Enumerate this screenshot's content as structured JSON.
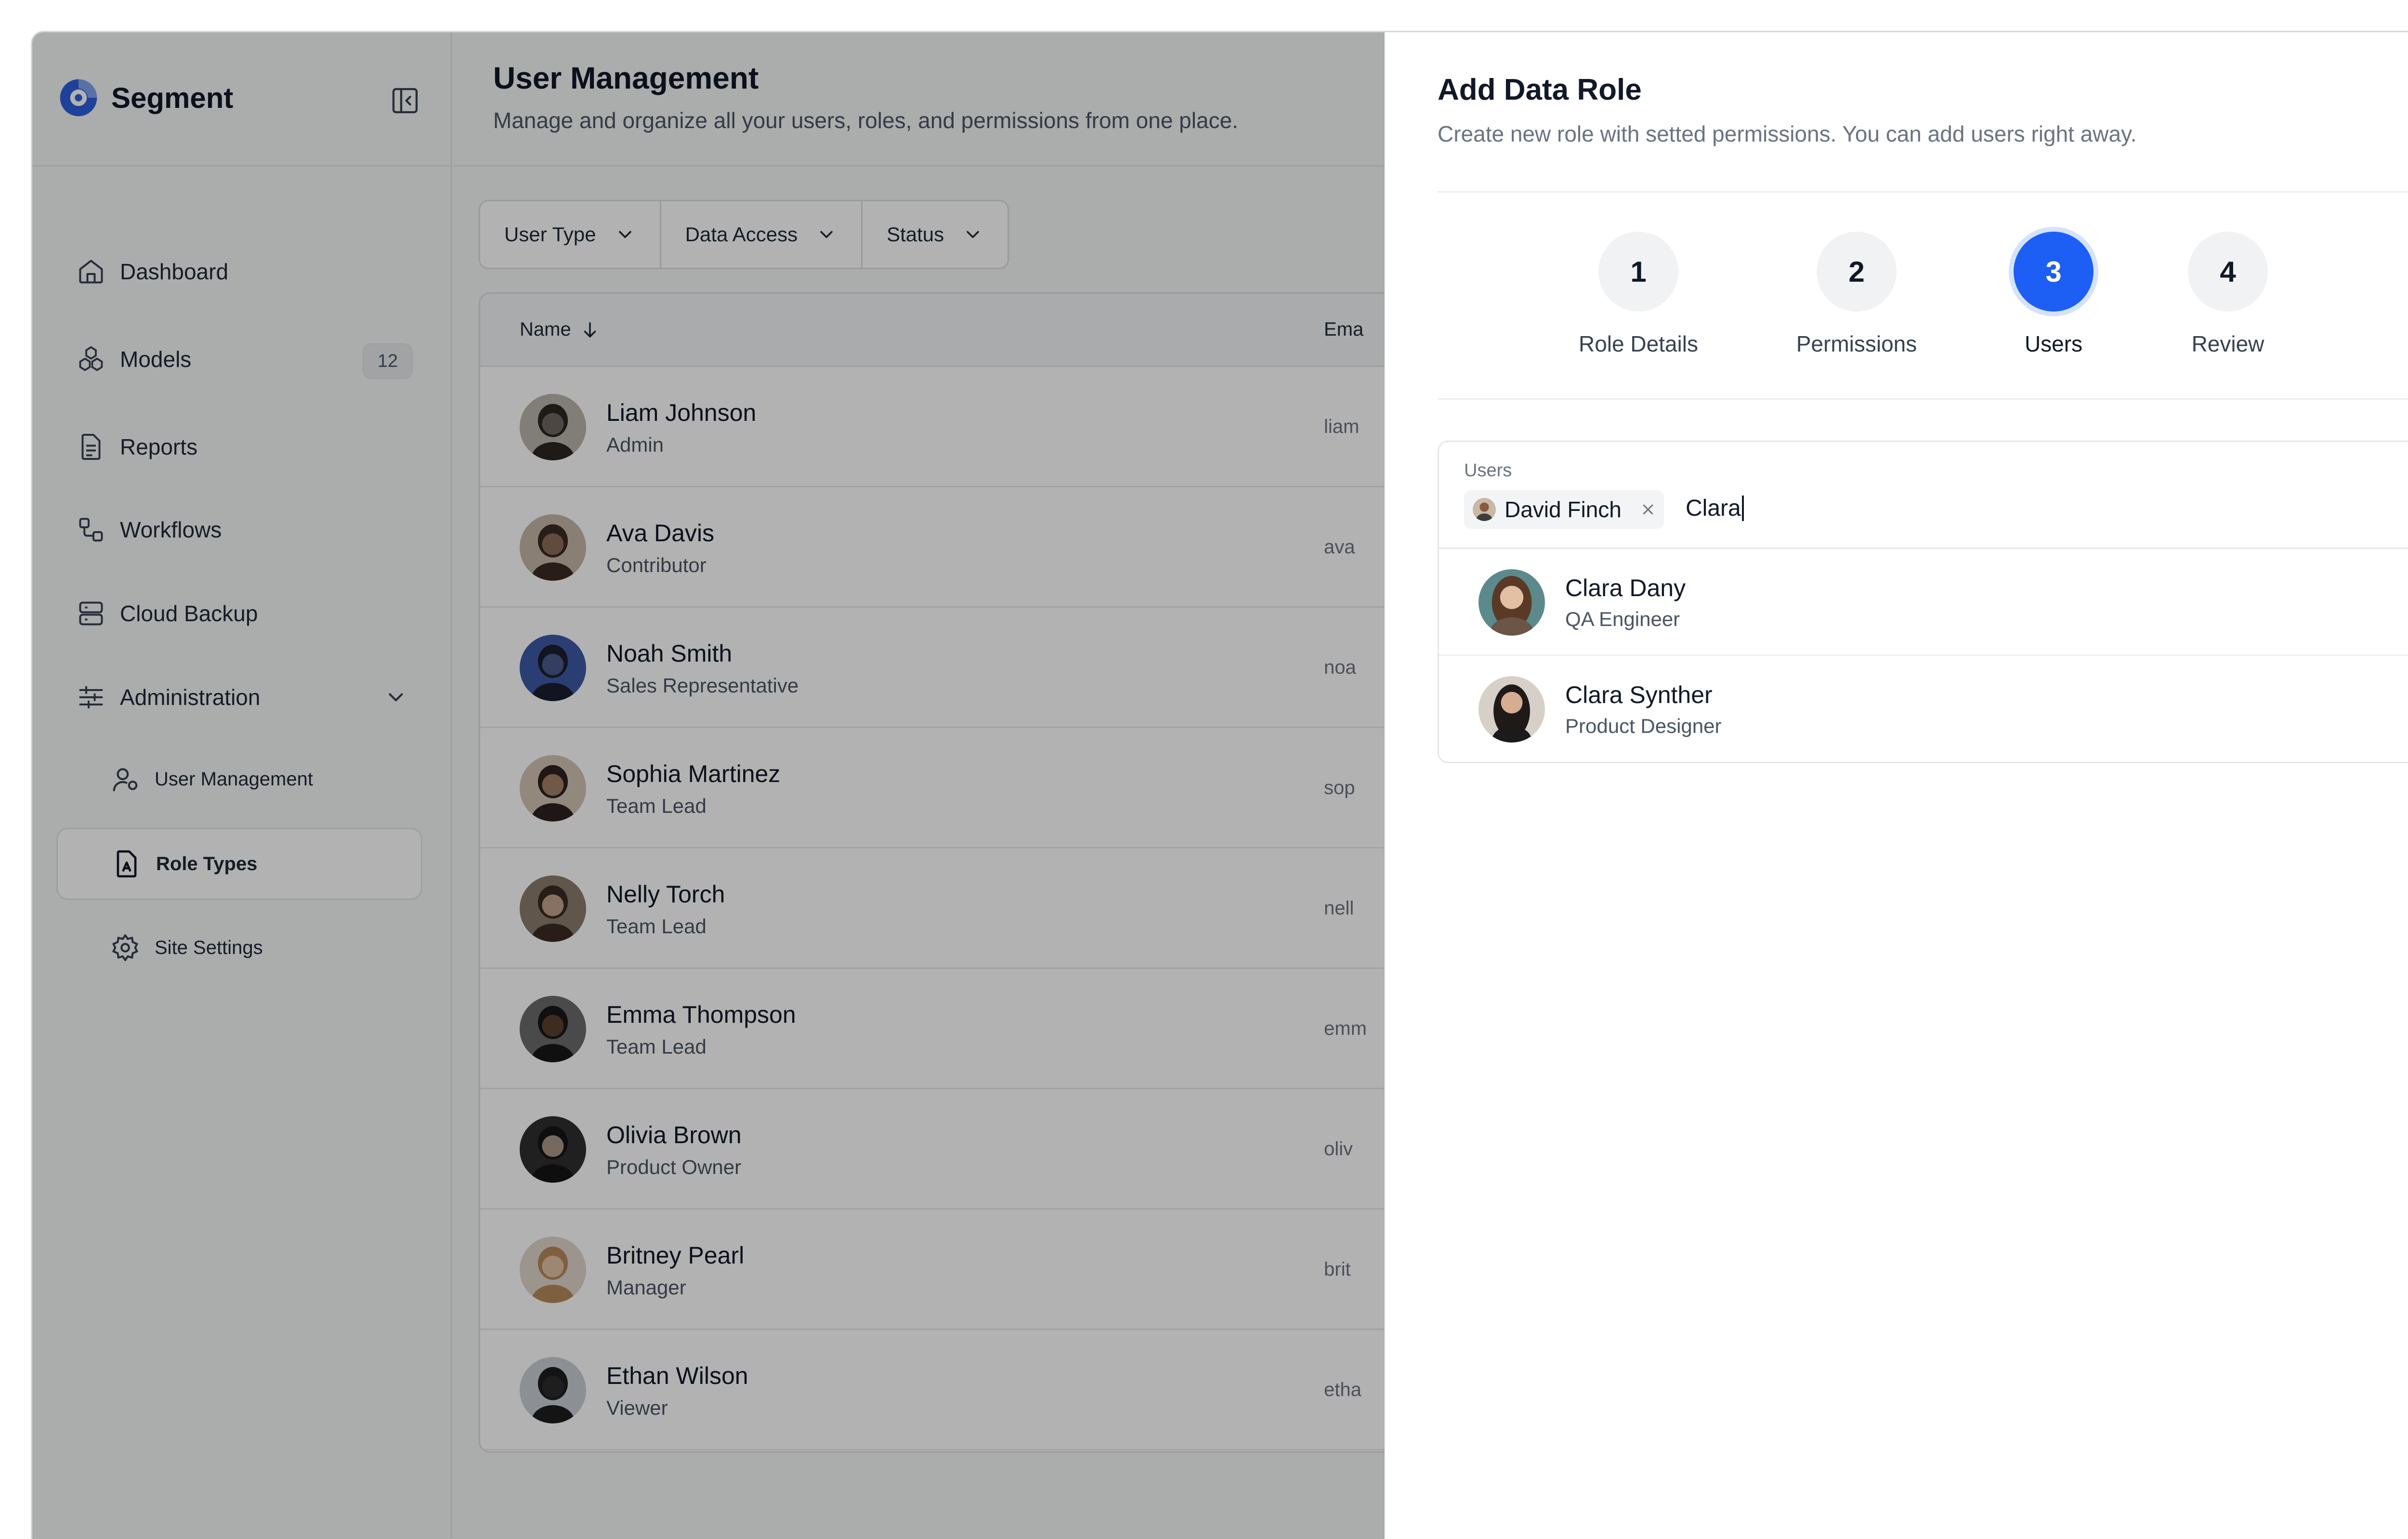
{
  "brand": {
    "name": "Segment"
  },
  "sidebar": {
    "items": [
      {
        "label": "Dashboard",
        "icon": "home-icon"
      },
      {
        "label": "Models",
        "icon": "cube-icon",
        "count": "12"
      },
      {
        "label": "Reports",
        "icon": "document-icon"
      },
      {
        "label": "Workflows",
        "icon": "workflow-icon"
      },
      {
        "label": "Cloud Backup",
        "icon": "server-icon"
      },
      {
        "label": "Administration",
        "icon": "sliders-icon"
      }
    ],
    "subitems": [
      {
        "label": "User Management",
        "icon": "user-gear-icon"
      },
      {
        "label": "Role Types",
        "icon": "role-file-icon",
        "active": true
      },
      {
        "label": "Site Settings",
        "icon": "gear-icon"
      }
    ]
  },
  "main": {
    "title": "User Management",
    "subtitle": "Manage and organize all your users, roles, and permissions from one place.",
    "filters": [
      "User Type",
      "Data Access",
      "Status"
    ],
    "table": {
      "columns": {
        "name": "Name",
        "email": "Ema"
      },
      "rows": [
        {
          "name": "Liam Johnson",
          "role": "Admin",
          "email": "liam"
        },
        {
          "name": "Ava Davis",
          "role": "Contributor",
          "email": "ava"
        },
        {
          "name": "Noah Smith",
          "role": "Sales Representative",
          "email": "noa"
        },
        {
          "name": "Sophia Martinez",
          "role": "Team Lead",
          "email": "sop"
        },
        {
          "name": "Nelly Torch",
          "role": "Team Lead",
          "email": "nell"
        },
        {
          "name": "Emma Thompson",
          "role": "Team Lead",
          "email": "emm"
        },
        {
          "name": "Olivia Brown",
          "role": "Product Owner",
          "email": "oliv"
        },
        {
          "name": "Britney Pearl",
          "role": "Manager",
          "email": "brit"
        },
        {
          "name": "Ethan Wilson",
          "role": "Viewer",
          "email": "etha"
        }
      ]
    }
  },
  "drawer": {
    "title": "Add Data Role",
    "subtitle": "Create new role with setted permissions. You can add users right away.",
    "steps": [
      {
        "number": "1",
        "label": "Role Details"
      },
      {
        "number": "2",
        "label": "Permissions"
      },
      {
        "number": "3",
        "label": "Users",
        "active": true
      },
      {
        "number": "4",
        "label": "Review"
      }
    ],
    "users_field": {
      "label": "Users",
      "chip": "David Finch",
      "typed": "Clara"
    },
    "suggestions": [
      {
        "name": "Clara Dany",
        "role": "QA Engineer"
      },
      {
        "name": "Clara Synther",
        "role": "Product Designer"
      }
    ]
  },
  "colors": {
    "accent": "#1d5ff5",
    "overlay": "rgba(0,0,0,0.30)"
  }
}
